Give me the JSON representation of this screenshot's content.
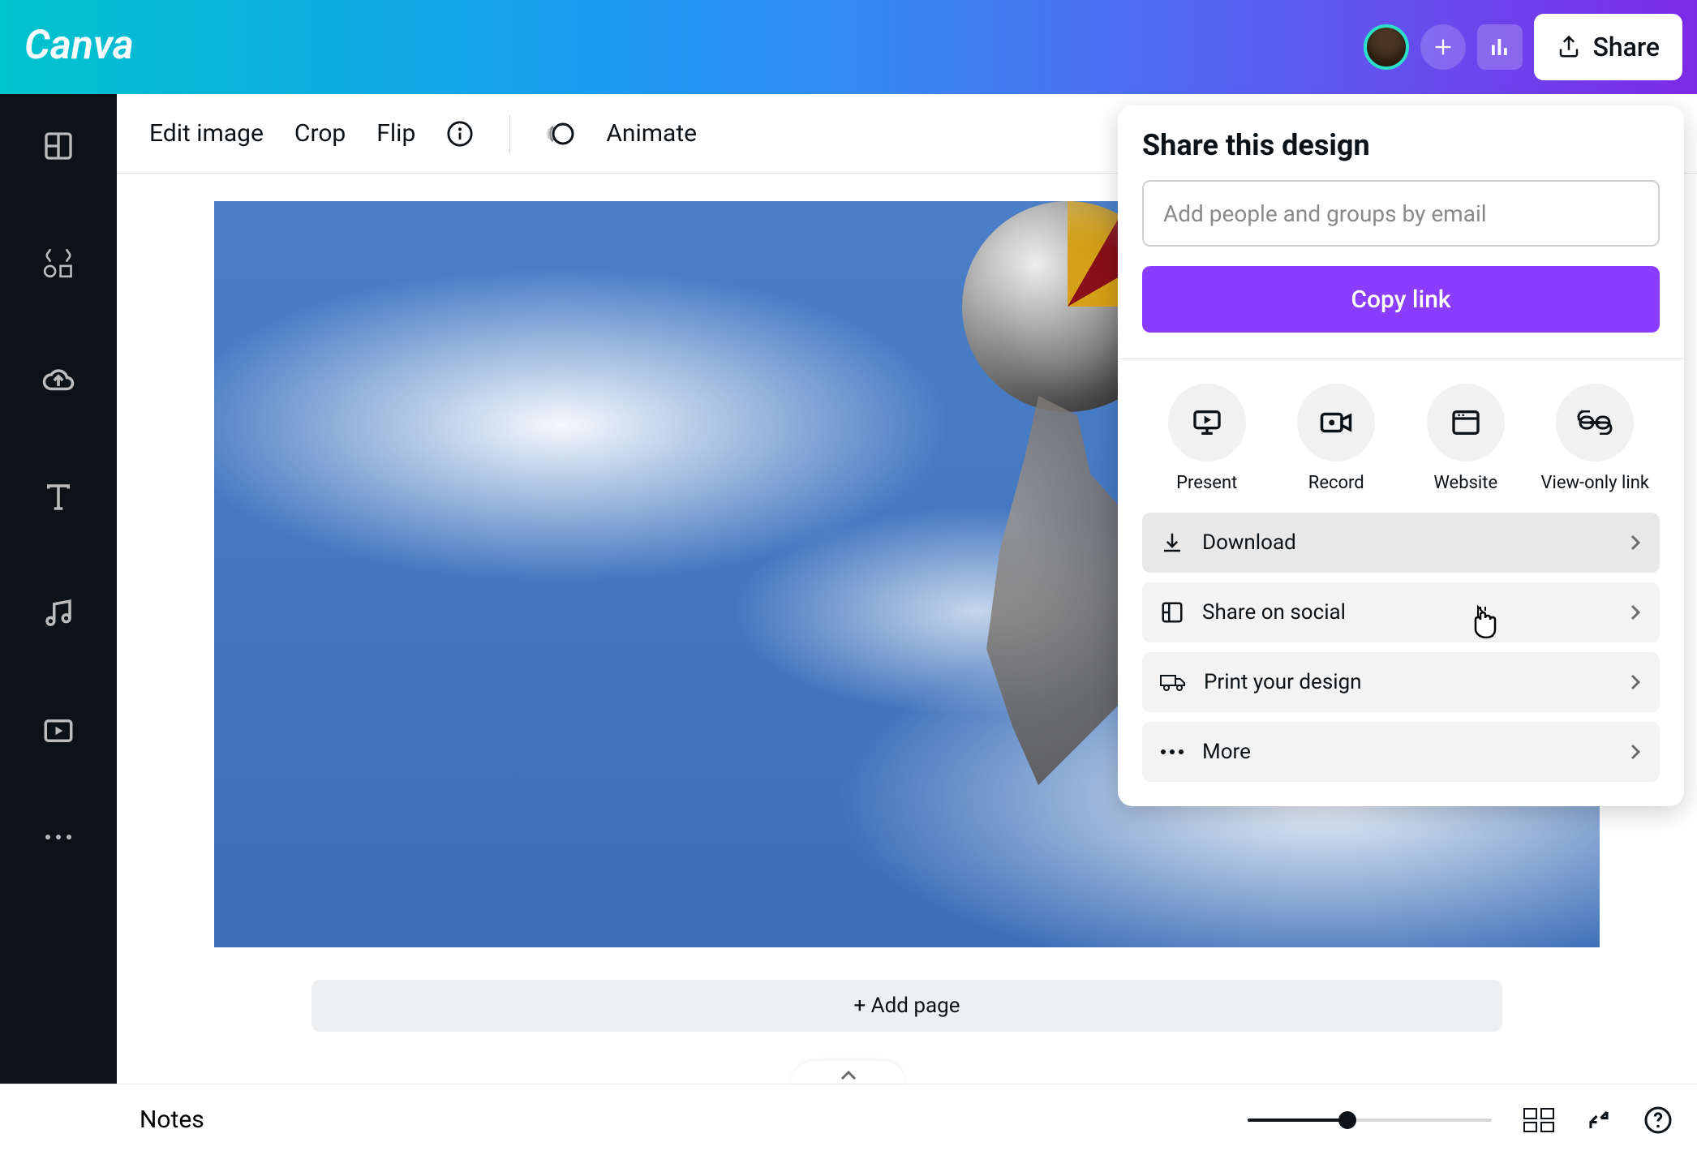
{
  "brand": "Canva",
  "topbar": {
    "share_label": "Share"
  },
  "toolbar": {
    "edit_image": "Edit image",
    "crop": "Crop",
    "flip": "Flip",
    "animate": "Animate"
  },
  "canvas": {
    "add_page": "+ Add page"
  },
  "share_panel": {
    "title": "Share this design",
    "input_placeholder": "Add people and groups by email",
    "copy_link": "Copy link",
    "quick": [
      {
        "label": "Present"
      },
      {
        "label": "Record"
      },
      {
        "label": "Website"
      },
      {
        "label": "View-only link"
      }
    ],
    "list": [
      {
        "label": "Download"
      },
      {
        "label": "Share on social"
      },
      {
        "label": "Print your design"
      },
      {
        "label": "More"
      }
    ]
  },
  "bottombar": {
    "notes": "Notes"
  }
}
